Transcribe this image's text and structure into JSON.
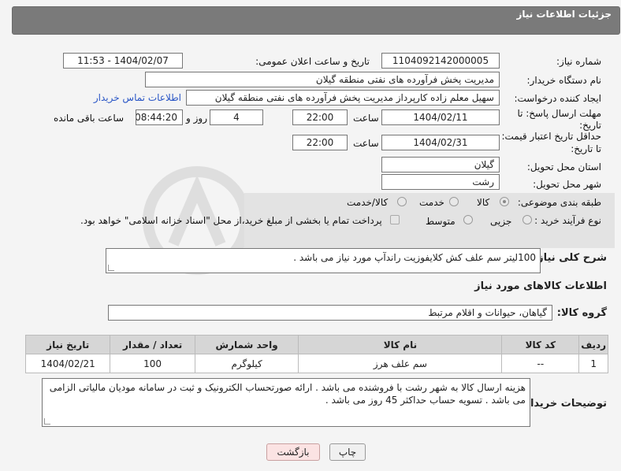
{
  "header": {
    "title": "جزئیات اطلاعات نیاز"
  },
  "fields": {
    "need_number_label": "شماره نیاز:",
    "need_number": "1104092142000005",
    "announce_label": "تاریخ و ساعت اعلان عمومی:",
    "announce_value": "1404/02/07 - 11:53",
    "buyer_org_label": "نام دستگاه خریدار:",
    "buyer_org": "مدیریت پخش فرآورده های نفتی منطقه گیلان",
    "requester_label": "ایجاد کننده درخواست:",
    "requester": "سهیل معلم زاده کارپرداز مدیریت پخش فرآورده های نفتی منطقه گیلان",
    "contact_link": "اطلاعات تماس خریدار",
    "reply_deadline_label_1": "مهلت ارسال پاسخ: تا",
    "reply_deadline_label_2": "تاریخ:",
    "reply_date": "1404/02/11",
    "time_label": "ساعت",
    "reply_time": "22:00",
    "days_value": "4",
    "days_label": "روز و",
    "remaining_time": "08:44:20",
    "remaining_label": "ساعت باقی مانده",
    "price_validity_label_1": "حداقل تاریخ اعتبار قیمت:",
    "price_validity_label_2": "تا تاریخ:",
    "price_date": "1404/02/31",
    "price_time": "22:00",
    "province_label": "استان محل تحویل:",
    "province": "گیلان",
    "city_label": "شهر محل تحویل:",
    "city": "رشت",
    "category_label": "طبقه بندی موضوعی:",
    "category_options": [
      "کالا",
      "خدمت",
      "کالا/خدمت"
    ],
    "process_label": "نوع فرآیند خرید :",
    "process_options": [
      "جزیی",
      "متوسط"
    ],
    "payment_note": "پرداخت تمام یا بخشی از مبلغ خرید،از محل \"اسناد خزانه اسلامی\" خواهد بود."
  },
  "description": {
    "label": "شرح کلی نیاز:",
    "text": "100لیتر سم علف کش کلایفوزیت راندآپ مورد نیاز می باشد ."
  },
  "goods_section": {
    "title": "اطلاعات کالاهای مورد نیاز",
    "group_label": "گروه کالا:",
    "group_value": "گیاهان، حیوانات و اقلام مرتبط"
  },
  "table": {
    "headers": [
      "ردیف",
      "کد کالا",
      "نام کالا",
      "واحد شمارش",
      "تعداد / مقدار",
      "تاریخ نیاز"
    ],
    "rows": [
      [
        "1",
        "--",
        "سم علف هرز",
        "کیلوگرم",
        "100",
        "1404/02/21"
      ]
    ]
  },
  "buyer_notes": {
    "label": "توضیحات خریدار:",
    "text": "هزینه ارسال کالا به شهر رشت با فروشنده می باشد . ارائه صورتحساب الکترونیک و ثبت در سامانه مودیان مالیاتی الزامی می باشد . تسویه حساب حداکثر 45 روز می باشد ."
  },
  "buttons": {
    "print": "چاپ",
    "back": "بازگشت"
  },
  "colors": {
    "header_bg": "#7a7a7a",
    "link": "#2a56c6",
    "table_header_bg": "#d6d6d6"
  }
}
